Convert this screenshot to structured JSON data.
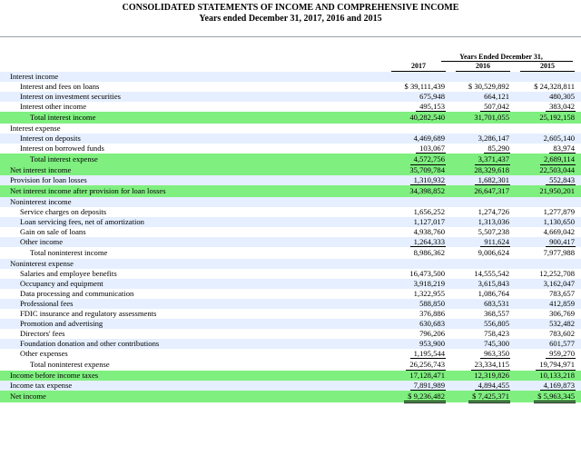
{
  "title": "CONSOLIDATED STATEMENTS OF INCOME AND COMPREHENSIVE INCOME",
  "subtitle": "Years ended December 31, 2017, 2016 and 2015",
  "column_group": "Years Ended December 31,",
  "years": [
    "2017",
    "2016",
    "2015"
  ],
  "rows": [
    {
      "label": "Interest income",
      "indent": 0,
      "style": "shade",
      "values": [
        "",
        "",
        ""
      ],
      "ul": ""
    },
    {
      "label": "Interest and fees on loans",
      "indent": 1,
      "style": "",
      "values": [
        "$ 39,111,439",
        "$ 30,529,892",
        "$ 24,328,811"
      ],
      "ul": ""
    },
    {
      "label": "Interest on investment securities",
      "indent": 1,
      "style": "shade",
      "values": [
        "675,948",
        "664,121",
        "480,305"
      ],
      "ul": ""
    },
    {
      "label": "Interest other income",
      "indent": 1,
      "style": "",
      "values": [
        "495,153",
        "507,042",
        "383,042"
      ],
      "ul": "single"
    },
    {
      "label": "Total interest income",
      "indent": 2,
      "style": "green",
      "values": [
        "40,282,540",
        "31,701,055",
        "25,192,158"
      ],
      "ul": "",
      "spaced": true
    },
    {
      "label": "Interest expense",
      "indent": 0,
      "style": "",
      "values": [
        "",
        "",
        ""
      ],
      "ul": ""
    },
    {
      "label": "Interest on deposits",
      "indent": 1,
      "style": "shade",
      "values": [
        "4,469,689",
        "3,286,147",
        "2,605,140"
      ],
      "ul": ""
    },
    {
      "label": "Interest on borrowed funds",
      "indent": 1,
      "style": "",
      "values": [
        "103,067",
        "85,290",
        "83,974"
      ],
      "ul": "single"
    },
    {
      "label": "Total interest expense",
      "indent": 2,
      "style": "green",
      "values": [
        "4,572,756",
        "3,371,437",
        "2,689,114"
      ],
      "ul": "single",
      "spaced": true
    },
    {
      "label": "Net interest income",
      "indent": 0,
      "style": "green",
      "values": [
        "35,709,784",
        "28,329,618",
        "22,503,044"
      ],
      "ul": ""
    },
    {
      "label": "Provision for loan losses",
      "indent": 0,
      "style": "shade",
      "values": [
        "1,310,932",
        "1,682,301",
        "552,843"
      ],
      "ul": "single"
    },
    {
      "label": "Net interest income after provision for loan losses",
      "indent": 0,
      "style": "green",
      "values": [
        "34,398,852",
        "26,647,317",
        "21,950,201"
      ],
      "ul": "",
      "spaced": true
    },
    {
      "label": "Noninterest income",
      "indent": 0,
      "style": "shade",
      "values": [
        "",
        "",
        ""
      ],
      "ul": ""
    },
    {
      "label": "Service charges on deposits",
      "indent": 1,
      "style": "",
      "values": [
        "1,656,252",
        "1,274,726",
        "1,277,879"
      ],
      "ul": ""
    },
    {
      "label": "Loan servicing fees, net of amortization",
      "indent": 1,
      "style": "shade",
      "values": [
        "1,127,017",
        "1,313,036",
        "1,130,650"
      ],
      "ul": ""
    },
    {
      "label": "Gain on sale of loans",
      "indent": 1,
      "style": "",
      "values": [
        "4,938,760",
        "5,507,238",
        "4,669,042"
      ],
      "ul": ""
    },
    {
      "label": "Other income",
      "indent": 1,
      "style": "shade",
      "values": [
        "1,264,333",
        "911,624",
        "900,417"
      ],
      "ul": "single"
    },
    {
      "label": "Total noninterest income",
      "indent": 2,
      "style": "",
      "values": [
        "8,986,362",
        "9,006,624",
        "7,977,988"
      ],
      "ul": "",
      "spaced": true
    },
    {
      "label": "Noninterest expense",
      "indent": 0,
      "style": "shade",
      "values": [
        "",
        "",
        ""
      ],
      "ul": ""
    },
    {
      "label": "Salaries and employee benefits",
      "indent": 1,
      "style": "",
      "values": [
        "16,473,500",
        "14,555,542",
        "12,252,708"
      ],
      "ul": ""
    },
    {
      "label": "Occupancy and equipment",
      "indent": 1,
      "style": "shade",
      "values": [
        "3,918,219",
        "3,615,843",
        "3,162,047"
      ],
      "ul": ""
    },
    {
      "label": "Data processing and communication",
      "indent": 1,
      "style": "",
      "values": [
        "1,322,955",
        "1,086,764",
        "783,657"
      ],
      "ul": ""
    },
    {
      "label": "Professional fees",
      "indent": 1,
      "style": "shade",
      "values": [
        "588,850",
        "683,531",
        "412,859"
      ],
      "ul": ""
    },
    {
      "label": "FDIC insurance and regulatory assessments",
      "indent": 1,
      "style": "",
      "values": [
        "376,886",
        "368,557",
        "306,769"
      ],
      "ul": ""
    },
    {
      "label": "Promotion and advertising",
      "indent": 1,
      "style": "shade",
      "values": [
        "630,683",
        "556,805",
        "532,482"
      ],
      "ul": ""
    },
    {
      "label": "Directors' fees",
      "indent": 1,
      "style": "",
      "values": [
        "796,206",
        "758,423",
        "783,602"
      ],
      "ul": ""
    },
    {
      "label": "Foundation donation and other contributions",
      "indent": 1,
      "style": "shade",
      "values": [
        "953,900",
        "745,300",
        "601,577"
      ],
      "ul": ""
    },
    {
      "label": "Other expenses",
      "indent": 1,
      "style": "",
      "values": [
        "1,195,544",
        "963,350",
        "959,270"
      ],
      "ul": "single"
    },
    {
      "label": "Total noninterest expense",
      "indent": 2,
      "style": "",
      "values": [
        "26,256,743",
        "23,334,115",
        "19,794,971"
      ],
      "ul": "single",
      "spaced": true
    },
    {
      "label": "Income before income taxes",
      "indent": 0,
      "style": "green",
      "values": [
        "17,128,471",
        "12,319,826",
        "10,133,218"
      ],
      "ul": ""
    },
    {
      "label": "Income tax expense",
      "indent": 0,
      "style": "shade",
      "values": [
        "7,891,989",
        "4,894,455",
        "4,169,873"
      ],
      "ul": "single"
    },
    {
      "label": "Net income",
      "indent": 0,
      "style": "green",
      "values": [
        "$ 9,236,482",
        "$ 7,425,371",
        "$ 5,963,345"
      ],
      "ul": "double",
      "spaced": true
    }
  ]
}
